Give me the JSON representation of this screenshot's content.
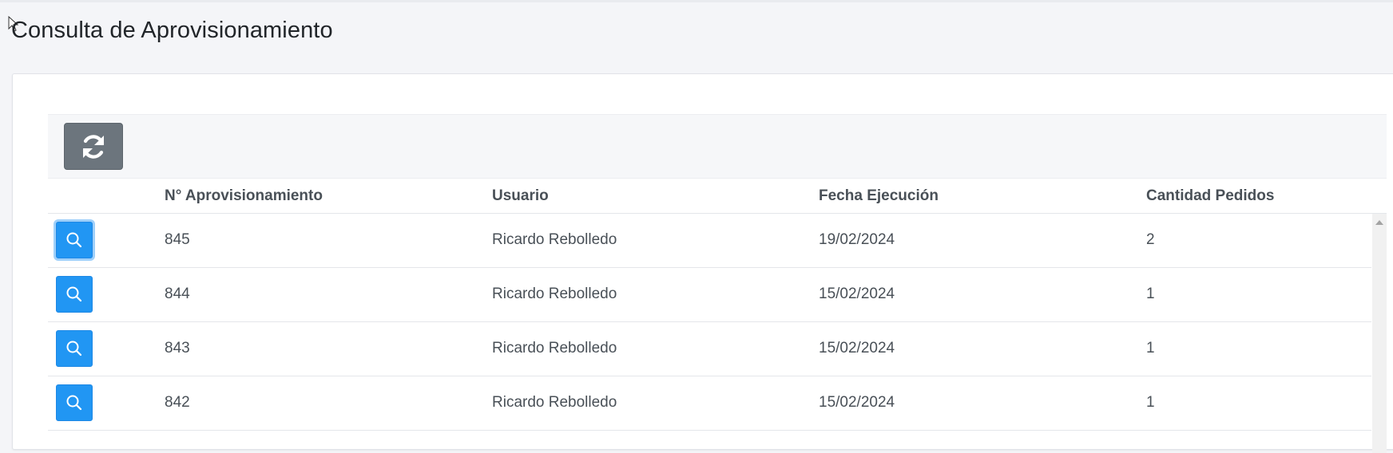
{
  "page": {
    "title": "Consulta de Aprovisionamiento"
  },
  "toolbar": {
    "refresh_icon": "refresh-icon"
  },
  "table": {
    "headers": [
      "N° Aprovisionamiento",
      "Usuario",
      "Fecha Ejecución",
      "Cantidad Pedidos"
    ],
    "rows": [
      {
        "numero": "845",
        "usuario": "Ricardo Rebolledo",
        "fecha": "19/02/2024",
        "cantidad": "2"
      },
      {
        "numero": "844",
        "usuario": "Ricardo Rebolledo",
        "fecha": "15/02/2024",
        "cantidad": "1"
      },
      {
        "numero": "843",
        "usuario": "Ricardo Rebolledo",
        "fecha": "15/02/2024",
        "cantidad": "1"
      },
      {
        "numero": "842",
        "usuario": "Ricardo Rebolledo",
        "fecha": "15/02/2024",
        "cantidad": "1"
      }
    ],
    "row_action_icon": "search-icon"
  },
  "colors": {
    "primary": "#2196f3",
    "secondary": "#6c757d",
    "background": "#f4f5f8",
    "text": "#495057"
  }
}
